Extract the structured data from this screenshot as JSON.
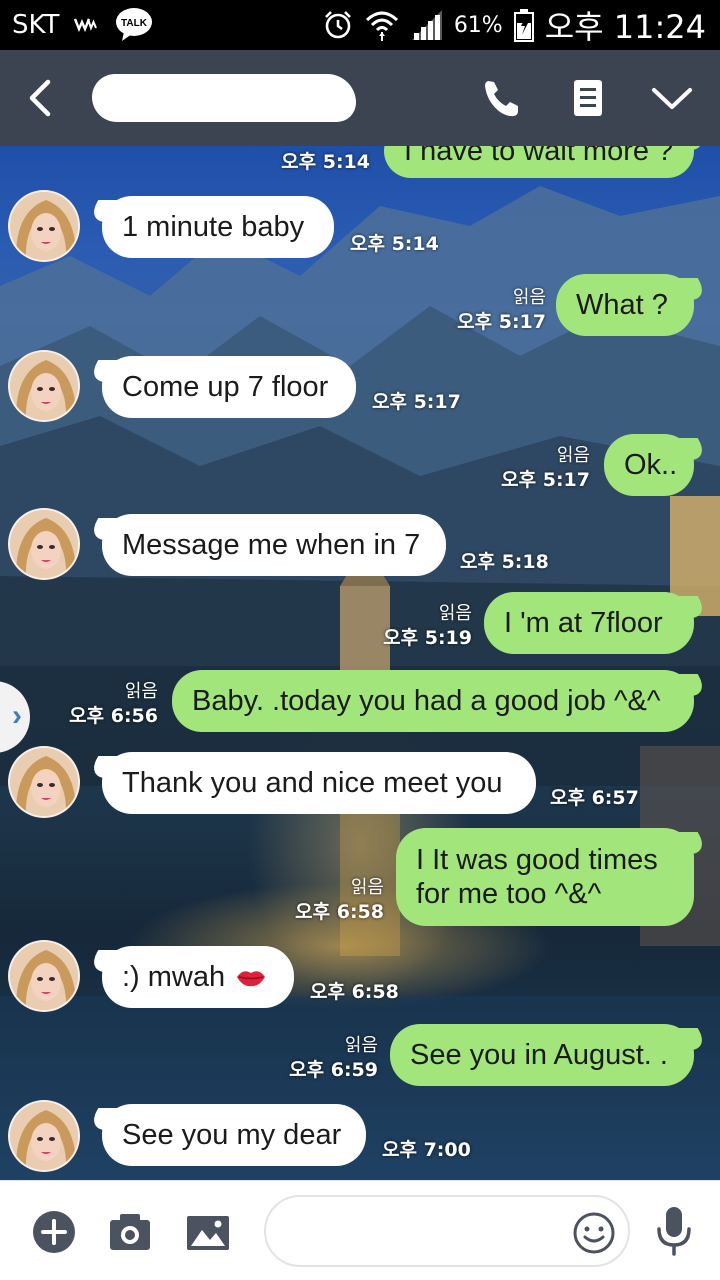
{
  "status_bar": {
    "carrier": "SKT",
    "battery": "61%",
    "time": "오후 11:24",
    "icons": [
      "w-icon",
      "talk-icon",
      "alarm-icon",
      "wifi-icon",
      "signal-icon",
      "battery-icon"
    ],
    "talk_label": "TALK"
  },
  "header": {
    "icons": [
      "back-icon",
      "phone-icon",
      "notes-icon",
      "chevron-down-icon"
    ]
  },
  "messages": [
    {
      "side": "out",
      "text": "I have to wait more ?",
      "time": "오후 5:14",
      "read": ""
    },
    {
      "side": "in",
      "text": "1 minute baby",
      "time": "오후 5:14"
    },
    {
      "side": "out",
      "text": "What ?",
      "time": "오후 5:17",
      "read": "읽음"
    },
    {
      "side": "in",
      "text": "Come up 7 floor",
      "time": "오후 5:17"
    },
    {
      "side": "out",
      "text": "Ok..",
      "time": "오후 5:17",
      "read": "읽음"
    },
    {
      "side": "in",
      "text": "Message me when in 7",
      "time": "오후 5:18"
    },
    {
      "side": "out",
      "text": "I 'm at 7floor",
      "time": "오후 5:19",
      "read": "읽음"
    },
    {
      "side": "out",
      "text": "Baby. .today you had a good job ^&^",
      "time": "오후 6:56",
      "read": "읽음"
    },
    {
      "side": "in",
      "text": "Thank you and nice meet you",
      "time": "오후 6:57"
    },
    {
      "side": "out",
      "text": "I It was good times for me too ^&^",
      "time": "오후 6:58",
      "read": "읽음"
    },
    {
      "side": "in",
      "text": ":) mwah",
      "time": "오후 6:58",
      "emoji": "lips-icon"
    },
    {
      "side": "out",
      "text": "See you in August. .",
      "time": "오후 6:59",
      "read": "읽음"
    },
    {
      "side": "in",
      "text": "See you my dear",
      "time": "오후 7:00"
    }
  ],
  "drawer_tab": {
    "glyph": "›"
  },
  "input_bar": {
    "placeholder": "",
    "icons": [
      "plus-icon",
      "camera-icon",
      "image-icon",
      "emoji-icon",
      "mic-icon"
    ]
  },
  "colors": {
    "header_bg": "#3d4451",
    "outgoing_bubble": "#a2e57b",
    "incoming_bubble": "#ffffff",
    "icon_gray": "#4b5260"
  }
}
